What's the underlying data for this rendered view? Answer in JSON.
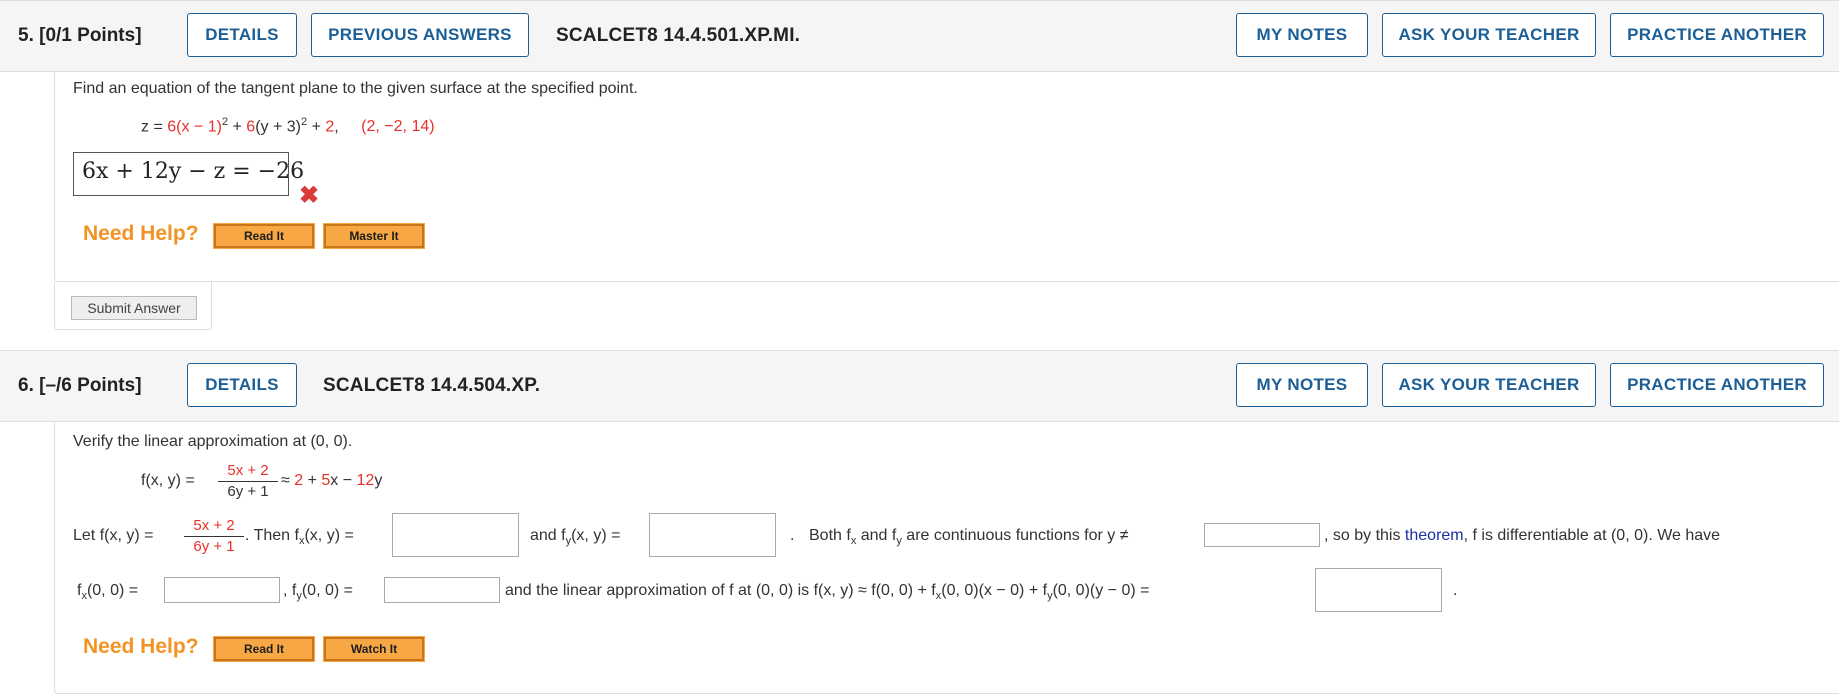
{
  "q5": {
    "number": "5. [0/1 Points]",
    "details_btn": "DETAILS",
    "previous_btn": "PREVIOUS ANSWERS",
    "ref": "SCALCET8 14.4.501.XP.MI.",
    "my_notes_btn": "MY NOTES",
    "ask_teacher_btn": "ASK YOUR TEACHER",
    "practice_btn": "PRACTICE ANOTHER",
    "prompt": "Find an equation of the tangent plane to the given surface at the specified point.",
    "eq_prefix": "z = ",
    "eq_c1": "6",
    "eq_t1": "(x − 1)",
    "eq_sup1": "2",
    "eq_plus1": " + ",
    "eq_c2": "6",
    "eq_t2": "(y + 3)",
    "eq_sup2": "2",
    "eq_plus2": " + ",
    "eq_c3": "2",
    "eq_comma": ",",
    "point_open": "(",
    "point_x": "2",
    "point_sep1": ", ",
    "point_y": "−2",
    "point_sep2": ", ",
    "point_z": "14",
    "point_close": ")",
    "answer": "6x + 12y − z = −26",
    "answer_status": "incorrect",
    "need_help": "Need Help?",
    "read_it": "Read It",
    "master_it": "Master It",
    "submit": "Submit Answer"
  },
  "q6": {
    "number": "6. [–/6 Points]",
    "details_btn": "DETAILS",
    "ref": "SCALCET8 14.4.504.XP.",
    "my_notes_btn": "MY NOTES",
    "ask_teacher_btn": "ASK YOUR TEACHER",
    "practice_btn": "PRACTICE ANOTHER",
    "prompt": "Verify the linear approximation at (0, 0).",
    "f_label": "f(x, y) = ",
    "frac_num": "5x + 2",
    "frac_den": "6y + 1",
    "approx": " ≈ ",
    "approx_a": "2",
    "approx_b": " + ",
    "approx_c": "5",
    "approx_d": "x − ",
    "approx_e": "12",
    "approx_f": "y",
    "let_label": "Let  f(x, y) = ",
    "then_text": ". Then f",
    "sub_x": "x",
    "then_tail": "(x, y) = ",
    "and_fy": "and f",
    "sub_y": "y",
    "and_fy_tail": "(x, y) = ",
    "period": ".",
    "both_text": "Both f",
    "both_and": " and f",
    "both_tail": " are continuous functions for y ≠",
    "so_text": ", so by this ",
    "theorem_link": "theorem",
    "so_tail": ", f is differentiable at (0, 0). We have",
    "fx00": "(0, 0) = ",
    "fy00_pre": ", f",
    "fy00": "(0, 0) = ",
    "linear_pre": "and the linear approximation of f at (0, 0) is f(x, y) ≈ f(0, 0) + f",
    "linear_mid": "(0, 0)(x − 0) + f",
    "linear_tail": "(0, 0)(y − 0) = ",
    "final_period": ".",
    "need_help": "Need Help?",
    "read_it": "Read It",
    "watch_it": "Watch It"
  },
  "colors": {
    "accent": "#1c5f96",
    "red_values": "#e8302a",
    "help_orange": "#f39324",
    "help_btn": "#f7a743",
    "wrong_x": "#d93a3a",
    "link": "#1a2fa0"
  }
}
